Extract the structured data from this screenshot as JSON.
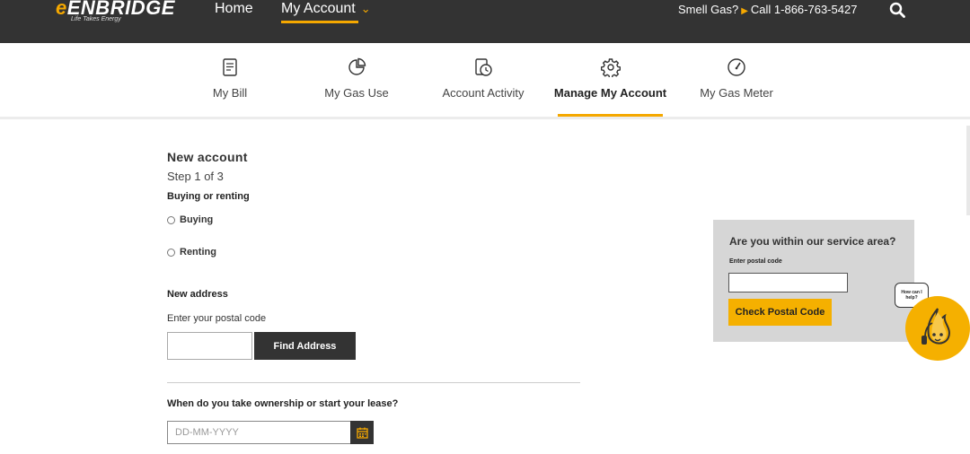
{
  "header": {
    "logo_text": "ENBRIDGE",
    "logo_tagline": "Life Takes Energy",
    "nav_home": "Home",
    "nav_account": "My Account",
    "smell_gas": "Smell Gas?",
    "call_text": "Call 1-866-763-5427"
  },
  "tabs": [
    {
      "label": "My Bill",
      "icon": "bill-icon"
    },
    {
      "label": "My Gas Use",
      "icon": "pie-chart-icon"
    },
    {
      "label": "Account Activity",
      "icon": "activity-clock-icon"
    },
    {
      "label": "Manage My Account",
      "icon": "gear-icon",
      "active": true
    },
    {
      "label": "My Gas Meter",
      "icon": "gauge-icon"
    }
  ],
  "form": {
    "title": "New account",
    "step": "Step 1 of 3",
    "buying_renting_label": "Buying or renting",
    "option_buying": "Buying",
    "option_renting": "Renting",
    "new_address_label": "New address",
    "postal_prompt": "Enter your postal code",
    "postal_value": "",
    "find_button": "Find Address",
    "ownership_question": "When do you take ownership or start your lease?",
    "date_placeholder": "DD-MM-YYYY"
  },
  "service_area": {
    "title": "Are you within our service area?",
    "postal_label": "Enter postal code",
    "postal_value": "",
    "button": "Check Postal Code"
  },
  "helper": {
    "bubble_text": "How can I help?"
  },
  "colors": {
    "accent": "#f5a800",
    "topbar": "#333333",
    "service_box": "#d6d6d6"
  }
}
